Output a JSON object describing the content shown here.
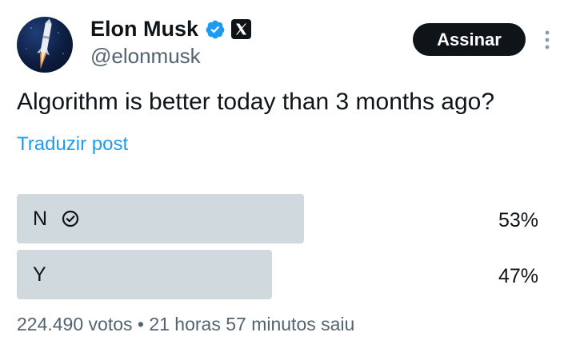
{
  "author": {
    "name": "Elon Musk",
    "handle": "@elonmusk",
    "verified_color": "#1d9bf0"
  },
  "subscribe_label": "Assinar",
  "post_text": "Algorithm is better today than 3 months ago?",
  "translate_label": "Traduzir post",
  "poll": {
    "options": [
      {
        "label": "N",
        "percent_text": "53%",
        "percent": 53,
        "winner": true
      },
      {
        "label": "Y",
        "percent_text": "47%",
        "percent": 47,
        "winner": false
      }
    ],
    "footer": "224.490 votos • 21 horas 57 minutos saiu"
  },
  "colors": {
    "accent": "#1d9bf0",
    "bar": "#cfd9de",
    "text": "#0f1419",
    "muted": "#536471",
    "button_bg": "#0f1419"
  },
  "icons": {
    "avatar": "rocket-avatar",
    "verified": "verified-badge-icon",
    "affiliate": "x-logo-icon",
    "more": "more-vertical-icon",
    "winner": "check-circle-icon"
  }
}
